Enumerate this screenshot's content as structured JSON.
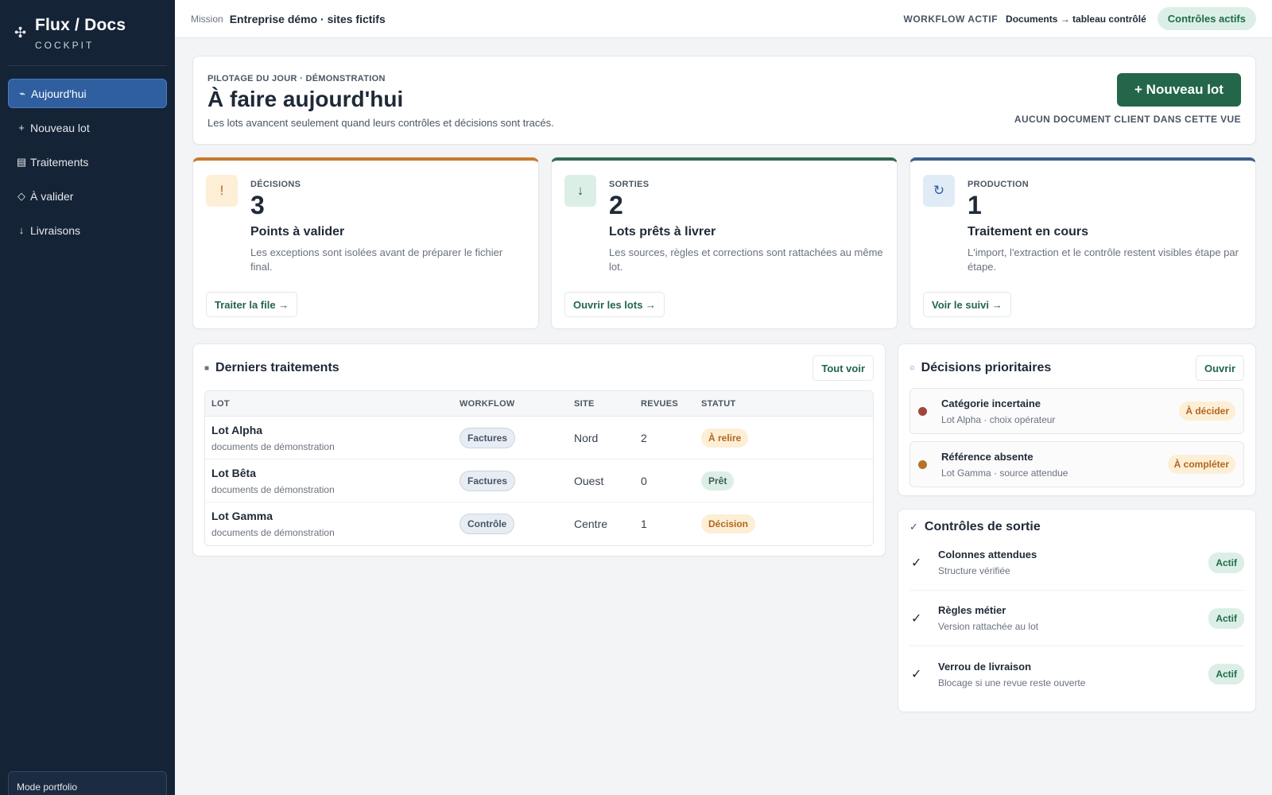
{
  "sidebar": {
    "brand_icon": "move-icon",
    "brand_title": "Flux / Docs",
    "brand_sub": "COCKPIT",
    "items": [
      {
        "icon": "⌁",
        "label": "Aujourd'hui",
        "active": true
      },
      {
        "icon": "+",
        "label": "Nouveau lot"
      },
      {
        "icon": "▤",
        "label": "Traitements"
      },
      {
        "icon": "◇",
        "label": "À valider"
      },
      {
        "icon": "↓",
        "label": "Livraisons"
      }
    ],
    "portfolio": "Mode portfolio"
  },
  "topbar": {
    "mission_label": "Mission",
    "mission_value": "Entreprise démo · sites fictifs",
    "workflow_label": "WORKFLOW ACTIF",
    "workflow_value": "Documents → tableau contrôlé",
    "controls_pill": "Contrôles actifs"
  },
  "hero": {
    "eyebrow": "PILOTAGE DU JOUR · DÉMONSTRATION",
    "title": "À faire aujourd'hui",
    "subtitle": "Les lots avancent seulement quand leurs contrôles et décisions sont tracés.",
    "new_button": "+ Nouveau lot",
    "note": "AUCUN DOCUMENT CLIENT DANS CETTE VUE"
  },
  "stats": [
    {
      "icon": "!",
      "label": "DÉCISIONS",
      "number": "3",
      "title": "Points à valider",
      "desc": "Les exceptions sont isolées avant de préparer le fichier final.",
      "button": "Traiter la file →",
      "accent": "#c77a2c",
      "icon_bg": "#fcefd6",
      "icon_color": "#b5651d"
    },
    {
      "icon": "↓",
      "label": "SORTIES",
      "number": "2",
      "title": "Lots prêts à livrer",
      "desc": "Les sources, règles et corrections sont rattachées au même lot.",
      "button": "Ouvrir les lots →",
      "accent": "#2f6b50",
      "icon_bg": "#dcefe6",
      "icon_color": "#1f6b4a"
    },
    {
      "icon": "↻",
      "label": "PRODUCTION",
      "number": "1",
      "title": "Traitement en cours",
      "desc": "L'import, l'extraction et le contrôle restent visibles étape par étape.",
      "button": "Voir le suivi →",
      "accent": "#3b5f8f",
      "icon_bg": "#e1ebf6",
      "icon_color": "#2f5f9e"
    }
  ],
  "recent": {
    "title": "Derniers traitements",
    "button": "Tout voir",
    "columns": [
      "LOT",
      "WORKFLOW",
      "SITE",
      "REVUES",
      "STATUT"
    ],
    "rows": [
      {
        "lot": "Lot Alpha",
        "sub": "documents de démonstration",
        "workflow": "Factures",
        "site": "Nord",
        "revues": "2",
        "status": "À relire",
        "status_bg": "#fcefd6",
        "status_color": "#b5651d"
      },
      {
        "lot": "Lot Bêta",
        "sub": "documents de démonstration",
        "workflow": "Factures",
        "site": "Ouest",
        "revues": "0",
        "status": "Prêt",
        "status_bg": "#dcefe6",
        "status_color": "#3f5f52"
      },
      {
        "lot": "Lot Gamma",
        "sub": "documents de démonstration",
        "workflow": "Contrôle",
        "site": "Centre",
        "revues": "1",
        "status": "Décision",
        "status_bg": "#fcefd6",
        "status_color": "#b5651d"
      }
    ]
  },
  "decisions": {
    "title": "Décisions prioritaires",
    "button": "Ouvrir",
    "items": [
      {
        "title": "Catégorie incertaine",
        "sub": "Lot Alpha · choix opérateur",
        "badge": "À décider",
        "dot": "#a1463a"
      },
      {
        "title": "Référence absente",
        "sub": "Lot Gamma · source attendue",
        "badge": "À compléter",
        "dot": "#b5732a"
      }
    ]
  },
  "controls": {
    "title": "Contrôles de sortie",
    "items": [
      {
        "title": "Colonnes attendues",
        "sub": "Structure vérifiée",
        "badge": "Actif"
      },
      {
        "title": "Règles métier",
        "sub": "Version rattachée au lot",
        "badge": "Actif"
      },
      {
        "title": "Verrou de livraison",
        "sub": "Blocage si une revue reste ouverte",
        "badge": "Actif"
      }
    ]
  }
}
